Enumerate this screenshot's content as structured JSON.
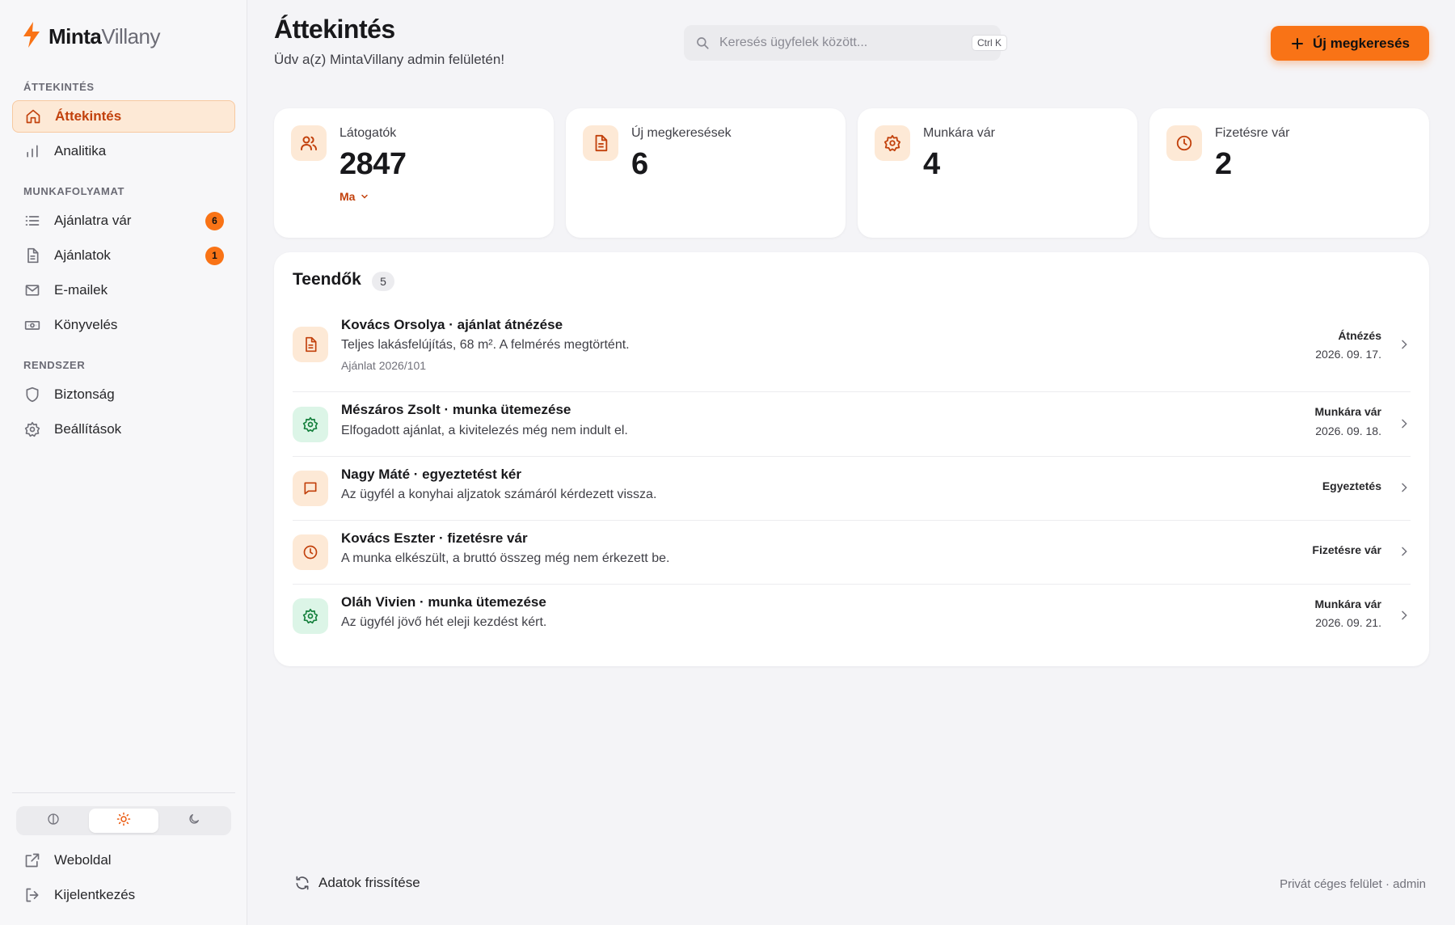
{
  "brand": {
    "name_bold": "Minta",
    "name_light": "Villany",
    "accent": "#f97316"
  },
  "sidebar": {
    "sections": [
      {
        "title": "ÁTTEKINTÉS"
      },
      {
        "title": "MUNKAFOLYAMAT"
      },
      {
        "title": "RENDSZER"
      }
    ],
    "items": [
      {
        "label": "Áttekintés",
        "icon": "home-icon",
        "active": true
      },
      {
        "label": "Analitika",
        "icon": "bar-chart-icon"
      },
      {
        "label": "Ajánlatra vár",
        "icon": "list-icon",
        "badge": "6"
      },
      {
        "label": "Ajánlatok",
        "icon": "document-icon",
        "badge": "1"
      },
      {
        "label": "E-mailek",
        "icon": "mail-icon"
      },
      {
        "label": "Könyvelés",
        "icon": "banknote-icon"
      },
      {
        "label": "Biztonság",
        "icon": "shield-icon"
      },
      {
        "label": "Beállítások",
        "icon": "gear-icon"
      }
    ],
    "theme": {
      "options": [
        "contrast-icon",
        "sun-icon",
        "moon-icon"
      ],
      "selected": "sun-icon"
    },
    "bottom": [
      {
        "label": "Weboldal",
        "icon": "external-link-icon"
      },
      {
        "label": "Kijelentkezés",
        "icon": "logout-icon"
      }
    ]
  },
  "header": {
    "title": "Áttekintés",
    "subtitle": "Üdv a(z) MintaVillany admin felületén!",
    "search_placeholder": "Keresés ügyfelek között...",
    "search_shortcut": "Ctrl K",
    "primary_button": "Új megkeresés"
  },
  "stats": [
    {
      "label": "Látogatók",
      "value": "2847",
      "filter": "Ma",
      "icon": "users-icon"
    },
    {
      "label": "Új megkeresések",
      "value": "6",
      "icon": "document-icon"
    },
    {
      "label": "Munkára vár",
      "value": "4",
      "icon": "gear-icon"
    },
    {
      "label": "Fizetésre vár",
      "value": "2",
      "icon": "clock-icon"
    }
  ],
  "tasks": {
    "title": "Teendők",
    "count": "5",
    "items": [
      {
        "title": "Kovács Orsolya · ajánlat átnézése",
        "desc": "Teljes lakásfelújítás, 68 m². A felmérés megtörtént.",
        "meta": "Ajánlat 2026/101",
        "status": "Átnézés",
        "date": "2026. 09. 17.",
        "icon": "document-icon",
        "tone": "orange"
      },
      {
        "title": "Mészáros Zsolt · munka ütemezése",
        "desc": "Elfogadott ajánlat, a kivitelezés még nem indult el.",
        "status": "Munkára vár",
        "date": "2026. 09. 18.",
        "icon": "gear-icon",
        "tone": "green"
      },
      {
        "title": "Nagy Máté · egyeztetést kér",
        "desc": "Az ügyfél a konyhai aljzatok számáról kérdezett vissza.",
        "status": "Egyeztetés",
        "icon": "chat-icon",
        "tone": "orange"
      },
      {
        "title": "Kovács Eszter · fizetésre vár",
        "desc": "A munka elkészült, a bruttó összeg még nem érkezett be.",
        "status": "Fizetésre vár",
        "icon": "clock-icon",
        "tone": "orange"
      },
      {
        "title": "Oláh Vivien · munka ütemezése",
        "desc": "Az ügyfél jövő hét eleji kezdést kért.",
        "status": "Munkára vár",
        "date": "2026. 09. 21.",
        "icon": "gear-icon",
        "tone": "green"
      }
    ]
  },
  "footer": {
    "refresh_label": "Adatok frissítése",
    "note": "Privát céges felület · admin"
  }
}
